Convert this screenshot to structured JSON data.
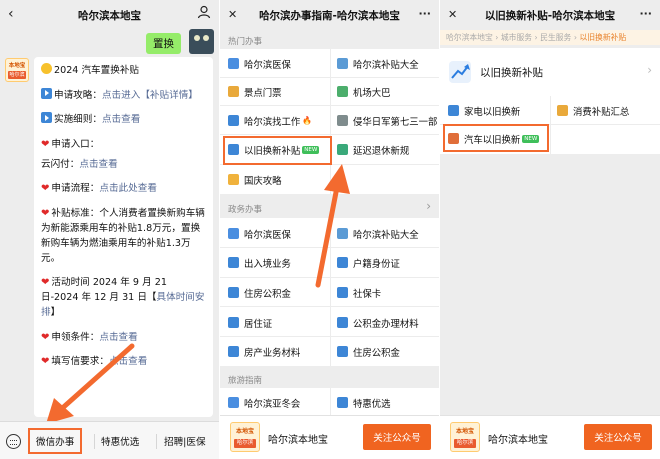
{
  "panel1": {
    "title": "哈尔滨本地宝",
    "back": "‹",
    "user_icon": "person-icon",
    "sent_message": "置换",
    "bot_avatar": {
      "top": "本地宝",
      "bottom": "哈尔滨"
    },
    "chat": {
      "line1_text": "2024 汽车置换补贴",
      "line2_prefix": "申请攻略：",
      "line2_link": "点击进入【补贴详情】",
      "line3_prefix": "实施细则：",
      "line3_link": "点击查看",
      "line4_text": "申请入口：",
      "line5_prefix": "云闪付：",
      "line5_link": "点击查看",
      "line6_prefix": "申请流程：",
      "line6_link": "点击此处查看",
      "line7_text": "补贴标准：个人消费者置换新购车辆为新能源乘用车的补贴1.8万元，置换新购车辆为燃油乘用车的补贴1.3万元。",
      "line8_prefix": "活动时间 2024 年 9 月 21 日-2024 年 12 月 31 日【",
      "line8_link": "具体时间安排",
      "line8_suffix": "】",
      "line9_prefix": "申领条件：",
      "line9_link": "点击查看",
      "line10_prefix": "填写信",
      "line10_mid": "要求：",
      "line10_link": "点击查看"
    },
    "menu": {
      "item1": "微信办事",
      "item2": "特惠优选",
      "item3": "招聘|医保"
    }
  },
  "panel2": {
    "title": "哈尔滨办事指南-哈尔滨本地宝",
    "close": "✕",
    "more": "···",
    "section1": {
      "title": "热门办事",
      "items": [
        "哈尔滨医保",
        "哈尔滨补贴大全",
        "景点门票",
        "机场大巴",
        "哈尔滨找工作",
        "侵华日军第七三一部...",
        "以旧换新补贴",
        "延迟退休新规",
        "国庆攻略"
      ],
      "badge": "NEW",
      "fire": "🔥"
    },
    "section2": {
      "title": "政务办事",
      "chevron": "›",
      "items": [
        "哈尔滨医保",
        "哈尔滨补贴大全",
        "出入境业务",
        "户籍身份证",
        "住房公积金",
        "社保卡",
        "居住证",
        "公积金办理材料",
        "房产业务材料",
        "住房公积金"
      ]
    },
    "section3": {
      "title": "旅游指南",
      "items": [
        "哈尔滨亚冬会",
        "特惠优选"
      ]
    },
    "follow": {
      "name": "哈尔滨本地宝",
      "button": "关注公众号",
      "logo_top": "本地宝",
      "logo_bottom": "哈尔滨"
    }
  },
  "panel3": {
    "title": "以旧换新补贴-哈尔滨本地宝",
    "close": "✕",
    "more": "···",
    "breadcrumbs": [
      "哈尔滨本地宝",
      "城市服务",
      "民生服务"
    ],
    "breadcrumb_current": "以旧换新补贴",
    "breadcrumb_sep": "›",
    "hero_label": "以旧换新补贴",
    "hero_chevron": "›",
    "items": [
      "家电以旧换新",
      "消费补贴汇总",
      "汽车以旧换新"
    ],
    "badge": "NEW",
    "follow": {
      "name": "哈尔滨本地宝",
      "button": "关注公众号",
      "logo_top": "本地宝",
      "logo_bottom": "哈尔滨"
    }
  },
  "colors": {
    "accent": "#f36a2f",
    "follow_button": "#f06420",
    "link": "#576b95",
    "bubble_green": "#95ec69"
  }
}
